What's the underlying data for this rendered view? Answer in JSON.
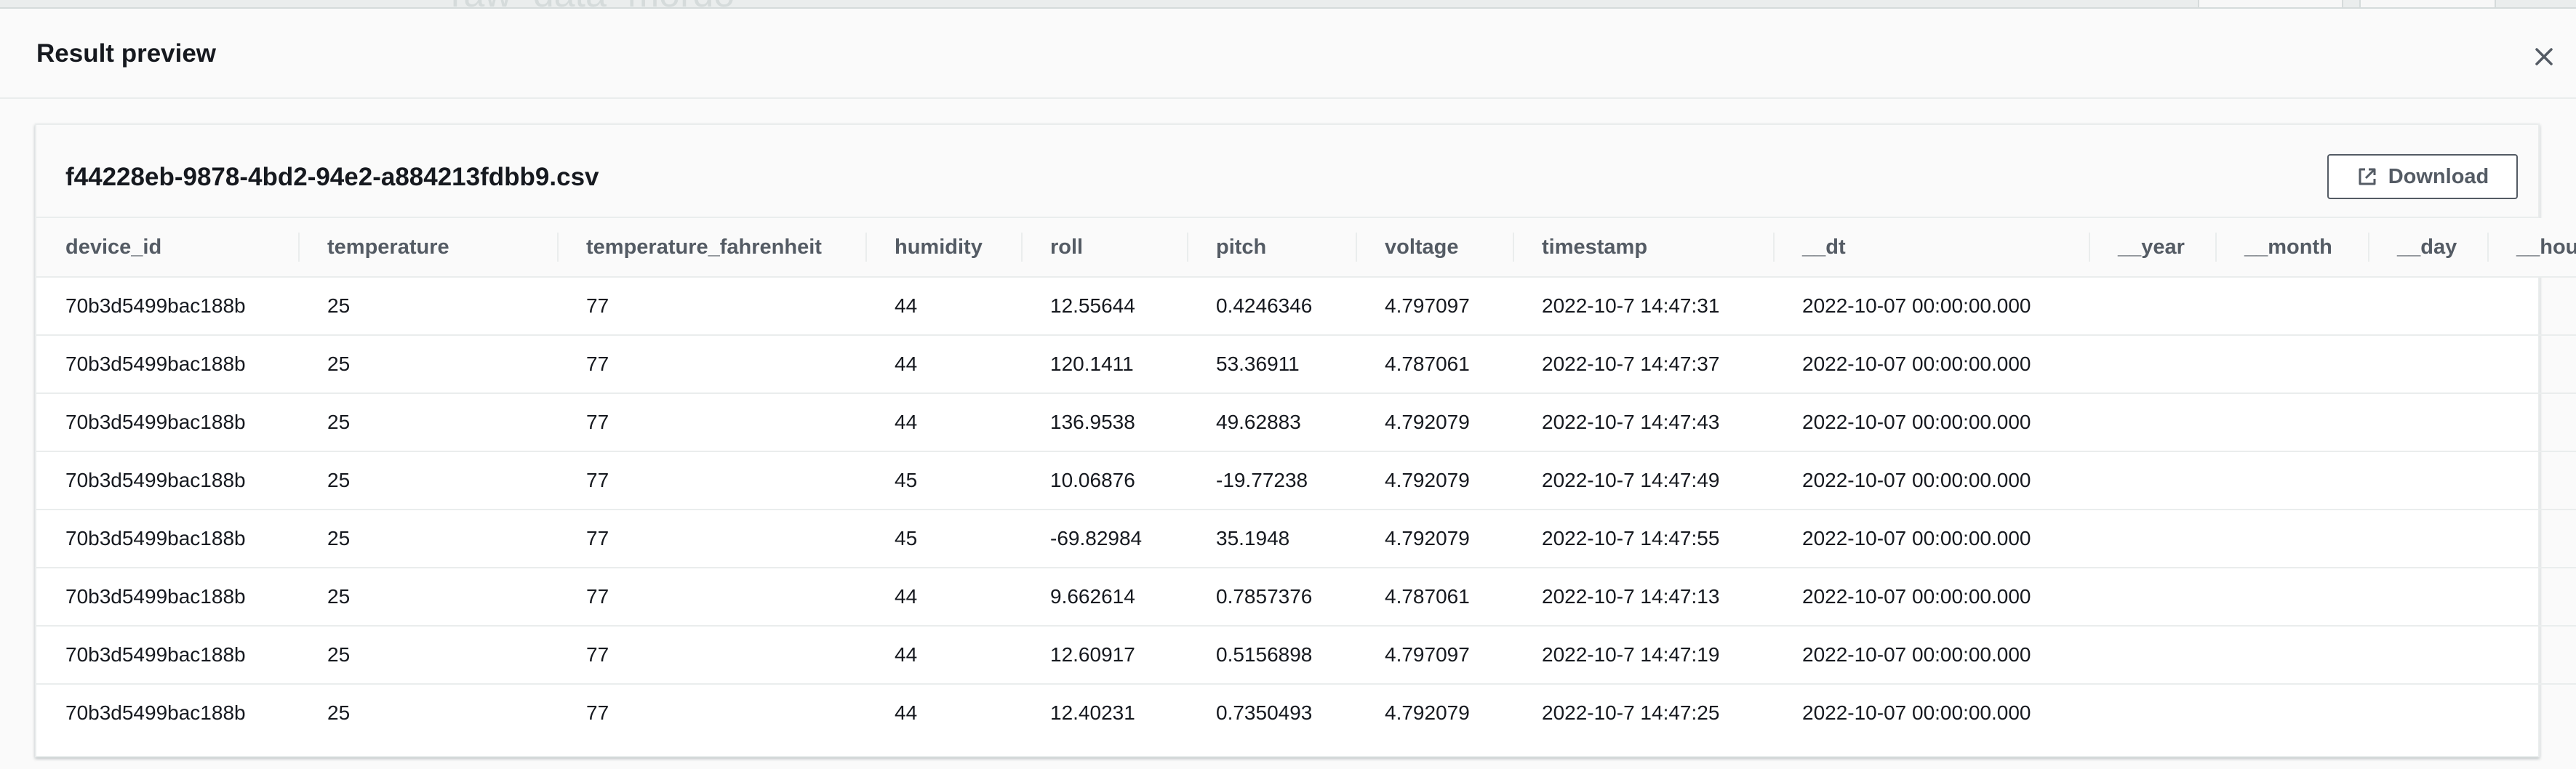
{
  "background": {
    "ghost_title": "raw_data_mordo"
  },
  "modal": {
    "title": "Result preview",
    "close_icon": "close-icon"
  },
  "panel": {
    "file_name": "f44228eb-9878-4bd2-94e2-a884213fdbb9.csv",
    "download_label": "Download",
    "download_icon": "external-link-icon"
  },
  "table": {
    "columns": [
      "device_id",
      "temperature",
      "temperature_fahrenheit",
      "humidity",
      "roll",
      "pitch",
      "voltage",
      "timestamp",
      "__dt",
      "__year",
      "__month",
      "__day",
      "__hour"
    ],
    "rows": [
      [
        "70b3d5499bac188b",
        "25",
        "77",
        "44",
        "12.55644",
        "0.4246346",
        "4.797097",
        "2022-10-7 14:47:31",
        "2022-10-07 00:00:00.000",
        "",
        "",
        "",
        ""
      ],
      [
        "70b3d5499bac188b",
        "25",
        "77",
        "44",
        "120.1411",
        "53.36911",
        "4.787061",
        "2022-10-7 14:47:37",
        "2022-10-07 00:00:00.000",
        "",
        "",
        "",
        ""
      ],
      [
        "70b3d5499bac188b",
        "25",
        "77",
        "44",
        "136.9538",
        "49.62883",
        "4.792079",
        "2022-10-7 14:47:43",
        "2022-10-07 00:00:00.000",
        "",
        "",
        "",
        ""
      ],
      [
        "70b3d5499bac188b",
        "25",
        "77",
        "45",
        "10.06876",
        "-19.77238",
        "4.792079",
        "2022-10-7 14:47:49",
        "2022-10-07 00:00:00.000",
        "",
        "",
        "",
        ""
      ],
      [
        "70b3d5499bac188b",
        "25",
        "77",
        "45",
        "-69.82984",
        "35.1948",
        "4.792079",
        "2022-10-7 14:47:55",
        "2022-10-07 00:00:00.000",
        "",
        "",
        "",
        ""
      ],
      [
        "70b3d5499bac188b",
        "25",
        "77",
        "44",
        "9.662614",
        "0.7857376",
        "4.787061",
        "2022-10-7 14:47:13",
        "2022-10-07 00:00:00.000",
        "",
        "",
        "",
        ""
      ],
      [
        "70b3d5499bac188b",
        "25",
        "77",
        "44",
        "12.60917",
        "0.5156898",
        "4.797097",
        "2022-10-7 14:47:19",
        "2022-10-07 00:00:00.000",
        "",
        "",
        "",
        ""
      ],
      [
        "70b3d5499bac188b",
        "25",
        "77",
        "44",
        "12.40231",
        "0.7350493",
        "4.792079",
        "2022-10-7 14:47:25",
        "2022-10-07 00:00:00.000",
        "",
        "",
        "",
        ""
      ]
    ]
  }
}
